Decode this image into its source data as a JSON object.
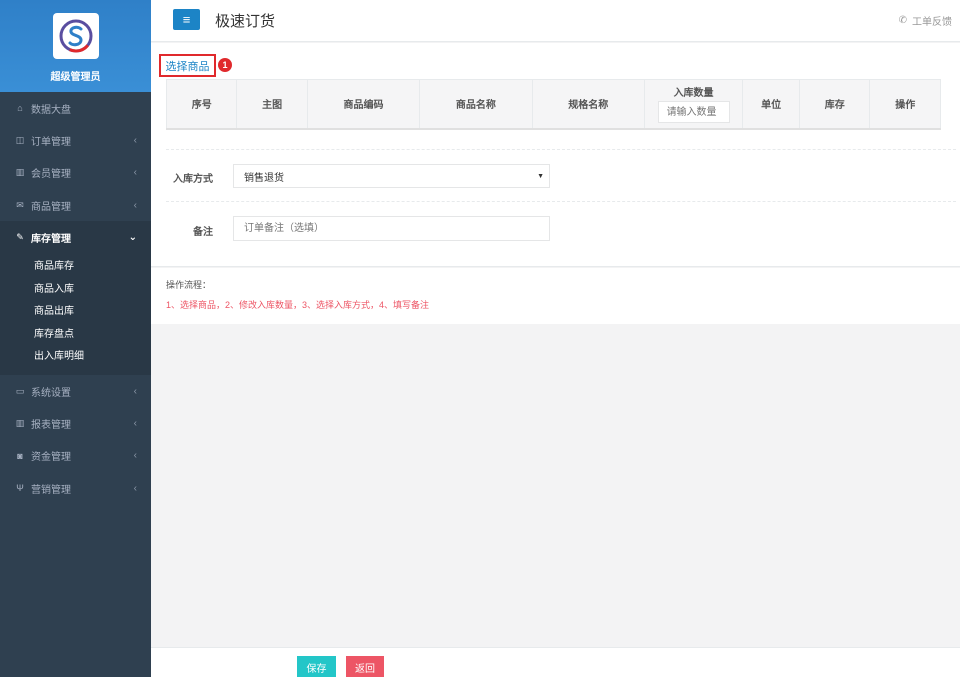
{
  "sidebar": {
    "profile_name": "超级管理员",
    "items": [
      {
        "label": "数据大盘",
        "icon": "home-icon",
        "glyph": "⌂",
        "expandable": false
      },
      {
        "label": "订单管理",
        "icon": "columns-icon",
        "glyph": "◫",
        "expandable": true
      },
      {
        "label": "会员管理",
        "icon": "bar-chart-icon",
        "glyph": "▥",
        "expandable": true
      },
      {
        "label": "商品管理",
        "icon": "envelope-icon",
        "glyph": "✉",
        "expandable": true
      },
      {
        "label": "库存管理",
        "icon": "edit-icon",
        "glyph": "✎",
        "expandable": true,
        "active": true
      },
      {
        "label": "系统设置",
        "icon": "desktop-icon",
        "glyph": "▭",
        "expandable": true
      },
      {
        "label": "报表管理",
        "icon": "bar-chart-icon",
        "glyph": "▥",
        "expandable": true
      },
      {
        "label": "资金管理",
        "icon": "money-icon",
        "glyph": "◙",
        "expandable": true
      },
      {
        "label": "营销管理",
        "icon": "cutlery-icon",
        "glyph": "Ψ",
        "expandable": true
      }
    ],
    "sub_items": [
      "商品库存",
      "商品入库",
      "商品出库",
      "库存盘点",
      "出入库明细"
    ]
  },
  "header": {
    "title": "极速订货",
    "feedback": "工单反馈",
    "menu_icon": "menu-icon"
  },
  "main": {
    "select_goods": "选择商品",
    "badge": "1",
    "table_headers": {
      "index": "序号",
      "image": "主图",
      "code": "商品编码",
      "name": "商品名称",
      "spec": "规格名称",
      "qty": "入库数量",
      "unit": "单位",
      "stock": "库存",
      "action": "操作"
    },
    "qty_placeholder": "请输入数量",
    "inbound_label": "入库方式",
    "inbound_value": "销售退货",
    "remark_label": "备注",
    "remark_placeholder": "订单备注（选填）"
  },
  "steps": {
    "title": "操作流程：",
    "text": "1、选择商品，2、修改入库数量，3、选择入库方式，4、填写备注"
  },
  "footer": {
    "save": "保存",
    "back": "返回"
  },
  "colors": {
    "sidebar_bg": "#2f4050",
    "primary": "#1c84c6",
    "save": "#23c6c8",
    "danger": "#ed5565",
    "highlight": "#e0292c"
  }
}
